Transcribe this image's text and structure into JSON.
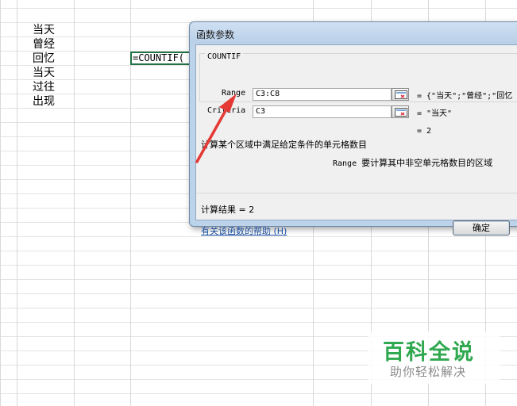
{
  "sheet": {
    "cells": [
      "当天",
      "曾经",
      "回忆",
      "当天",
      "过往",
      "出现"
    ],
    "formula_cell": "=COUNTIF("
  },
  "dialog": {
    "title": "函数参数",
    "function_name": "COUNTIF",
    "args": [
      {
        "label": "Range",
        "value": "C3:C8",
        "result": "= {\"当天\";\"曾经\";\"回忆"
      },
      {
        "label": "Criteria",
        "value": "C3",
        "result": "= \"当天\""
      }
    ],
    "function_result": "= 2",
    "description": "计算某个区域中满足给定条件的单元格数目",
    "arg_help_name": "Range",
    "arg_help_text": "要计算其中非空单元格数目的区域",
    "calc_result": "计算结果 =  2",
    "help_link": "有关该函数的帮助 (H)",
    "ok_label": "确定"
  },
  "watermark": {
    "brand": "百科全说",
    "slogan": "助你轻松解决"
  },
  "colors": {
    "accent_arrow": "#e53935",
    "brand_green": "#2fa84f",
    "selection_border": "#217346"
  }
}
